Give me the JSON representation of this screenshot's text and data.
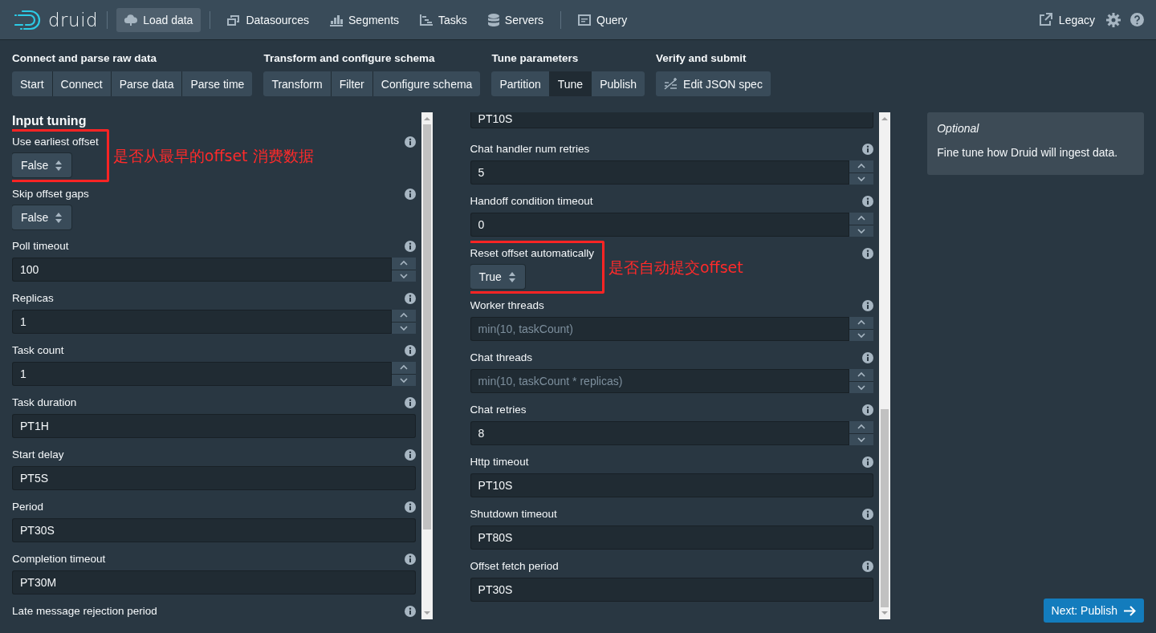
{
  "header": {
    "logo_text": "druid",
    "nav_groups": [
      [
        {
          "label": "Load data",
          "selected": true
        }
      ],
      [
        {
          "label": "Datasources",
          "selected": false
        },
        {
          "label": "Segments",
          "selected": false
        },
        {
          "label": "Tasks",
          "selected": false
        },
        {
          "label": "Servers",
          "selected": false
        }
      ],
      [
        {
          "label": "Query",
          "selected": false
        }
      ]
    ],
    "legacy_link": "Legacy"
  },
  "steps": [
    {
      "title": "Connect and parse raw data",
      "items": [
        {
          "label": "Start",
          "selected": false
        },
        {
          "label": "Connect",
          "selected": false
        },
        {
          "label": "Parse data",
          "selected": false
        },
        {
          "label": "Parse time",
          "selected": false
        }
      ]
    },
    {
      "title": "Transform and configure schema",
      "items": [
        {
          "label": "Transform",
          "selected": false
        },
        {
          "label": "Filter",
          "selected": false
        },
        {
          "label": "Configure schema",
          "selected": false
        }
      ]
    },
    {
      "title": "Tune parameters",
      "items": [
        {
          "label": "Partition",
          "selected": false
        },
        {
          "label": "Tune",
          "selected": true
        },
        {
          "label": "Publish",
          "selected": false
        }
      ]
    },
    {
      "title": "Verify and submit",
      "items": [
        {
          "label": "Edit JSON spec",
          "selected": false
        }
      ]
    }
  ],
  "left_column": {
    "heading": "Input tuning",
    "fields": [
      {
        "kind": "select",
        "label": "Use earliest offset",
        "value": "False",
        "annotation": "是否从最早的offset 消费数据"
      },
      {
        "kind": "select",
        "label": "Skip offset gaps",
        "value": "False"
      },
      {
        "kind": "number",
        "label": "Poll timeout",
        "value": "100"
      },
      {
        "kind": "number",
        "label": "Replicas",
        "value": "1"
      },
      {
        "kind": "number",
        "label": "Task count",
        "value": "1"
      },
      {
        "kind": "text",
        "label": "Task duration",
        "value": "PT1H"
      },
      {
        "kind": "text",
        "label": "Start delay",
        "value": "PT5S"
      },
      {
        "kind": "text",
        "label": "Period",
        "value": "PT30S"
      },
      {
        "kind": "text",
        "label": "Completion timeout",
        "value": "PT30M"
      },
      {
        "kind": "label_only",
        "label": "Late message rejection period"
      }
    ]
  },
  "middle_column": {
    "fields": [
      {
        "kind": "text",
        "value": "PT10S"
      },
      {
        "kind": "number",
        "label": "Chat handler num retries",
        "value": "5"
      },
      {
        "kind": "number",
        "label": "Handoff condition timeout",
        "value": "0"
      },
      {
        "kind": "select",
        "label": "Reset offset automatically",
        "value": "True",
        "annotation": "是否自动提交offset"
      },
      {
        "kind": "number",
        "label": "Worker threads",
        "placeholder": "min(10, taskCount)"
      },
      {
        "kind": "number",
        "label": "Chat threads",
        "placeholder": "min(10, taskCount * replicas)"
      },
      {
        "kind": "number",
        "label": "Chat retries",
        "value": "8"
      },
      {
        "kind": "text",
        "label": "Http timeout",
        "value": "PT10S"
      },
      {
        "kind": "text",
        "label": "Shutdown timeout",
        "value": "PT80S"
      },
      {
        "kind": "text",
        "label": "Offset fetch period",
        "value": "PT30S"
      }
    ]
  },
  "info_panel": {
    "title": "Optional",
    "text": "Fine tune how Druid will ingest data."
  },
  "next_button": "Next: Publish"
}
